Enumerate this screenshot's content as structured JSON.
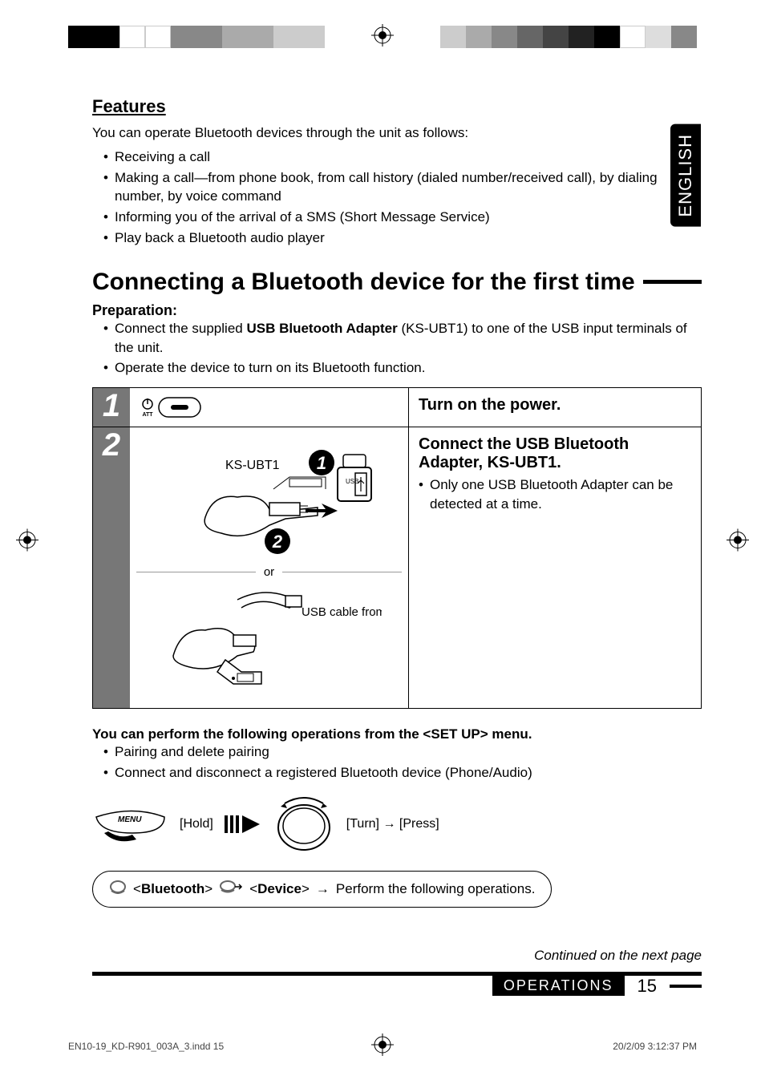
{
  "language_tab": "ENGLISH",
  "features": {
    "heading": "Features",
    "intro": "You can operate Bluetooth devices through the unit as follows:",
    "bullets": [
      "Receiving a call",
      "Making a call—from phone book, from call history (dialed number/received call), by dialing number, by voice command",
      "Informing you of the arrival of a SMS (Short Message Service)",
      "Play back a Bluetooth audio player"
    ]
  },
  "connecting": {
    "heading": "Connecting a Bluetooth device for the first time",
    "prep_title": "Preparation:",
    "prep_bullets_a": "Connect the supplied ",
    "prep_bold": "USB Bluetooth Adapter",
    "prep_bullets_b": " (KS-UBT1) to one of the USB input terminals of the unit.",
    "prep_bullet2": "Operate the device to turn on its Bluetooth function."
  },
  "steps": {
    "s1": {
      "num": "1",
      "att_label": "ATT",
      "right": "Turn on the power."
    },
    "s2": {
      "num": "2",
      "ksubt1": "KS-UBT1",
      "usb_label": "USB",
      "or": "or",
      "usb_cable": "USB cable from the rear of the unit",
      "right_line1": "Connect the USB Bluetooth Adapter, KS-UBT1.",
      "right_bullet": "Only one USB Bluetooth Adapter can be detected at a time."
    }
  },
  "setup": {
    "title_a": "You can perform the following operations from the <SET UP> menu.",
    "bullets": [
      "Pairing and delete pairing",
      "Connect and disconnect a registered Bluetooth device (Phone/Audio)"
    ],
    "menu_label": "MENU",
    "hold": "[Hold]",
    "turn": "[Turn]",
    "press": "[Press]",
    "arrow": "→"
  },
  "bt_box": {
    "bluetooth": "<Bluetooth>",
    "device": "<Device>",
    "tail": " Perform the following operations.",
    "arrow": "→"
  },
  "continued": "Continued on the next page",
  "footer": {
    "operations": "OPERATIONS",
    "page": "15"
  },
  "print_footer": {
    "left": "EN10-19_KD-R901_003A_3.indd   15",
    "right": "20/2/09   3:12:37 PM"
  }
}
